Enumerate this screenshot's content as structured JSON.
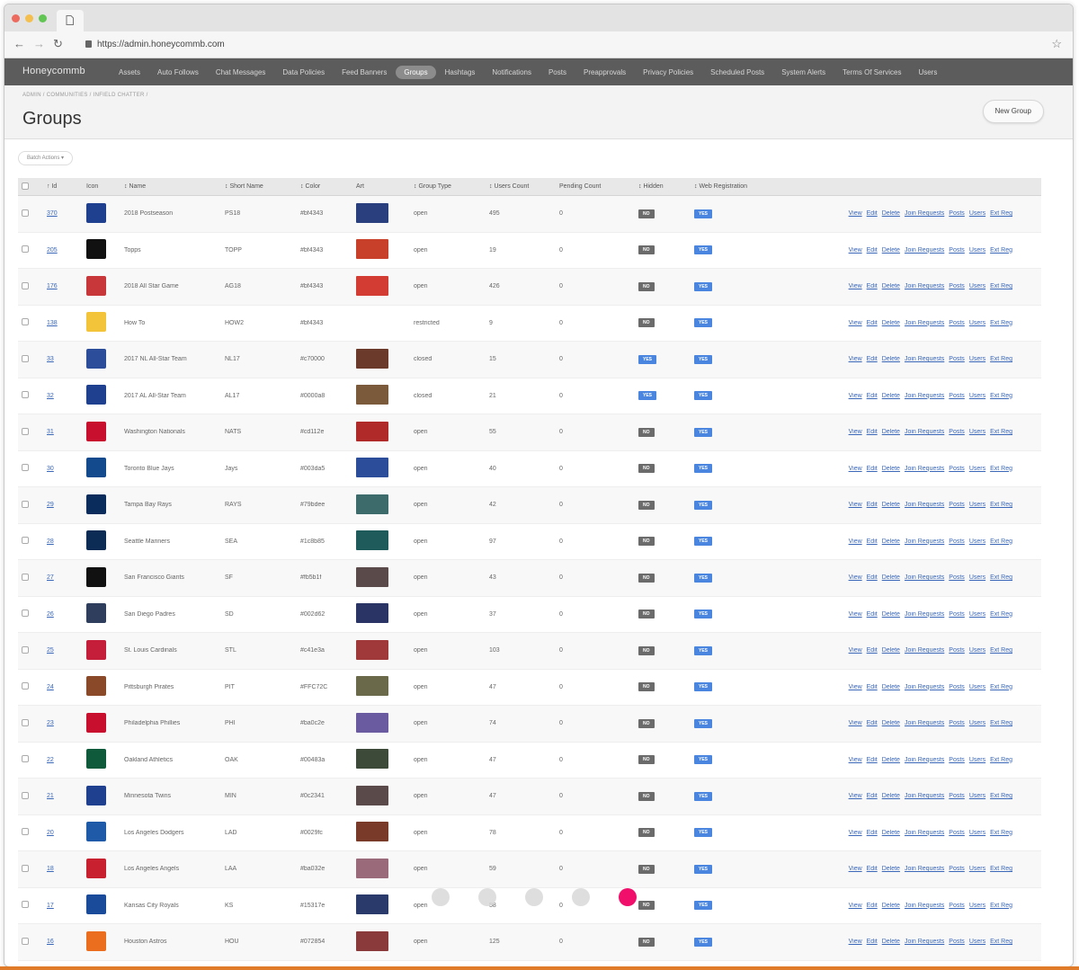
{
  "browser": {
    "url": "https://admin.honeycommb.com"
  },
  "app": {
    "brand": "Honeycommb",
    "nav": [
      "Assets",
      "Auto Follows",
      "Chat Messages",
      "Data Policies",
      "Feed Banners",
      "Groups",
      "Hashtags",
      "Notifications",
      "Posts",
      "Preapprovals",
      "Privacy Policies",
      "Scheduled Posts",
      "System Alerts",
      "Terms Of Services",
      "Users"
    ],
    "active_nav": "Groups"
  },
  "page": {
    "breadcrumb": "ADMIN / COMMUNITIES / INFIELD CHATTER /",
    "title": "Groups",
    "new_button": "New Group",
    "batch_actions": "Batch Actions ▾"
  },
  "table": {
    "headers": [
      "↑ Id",
      "Icon",
      "↕ Name",
      "↕ Short Name",
      "↕ Color",
      "Art",
      "↕ Group Type",
      "↕ Users Count",
      "Pending Count",
      "↕ Hidden",
      "↕ Web Registration"
    ],
    "actions": [
      "View",
      "Edit",
      "Delete",
      "Join Requests",
      "Posts",
      "Users",
      "Ext Reg"
    ],
    "rows": [
      {
        "id": "370",
        "name": "2018 Postseason",
        "short": "PS18",
        "color": "#bf4343",
        "type": "open",
        "users": "495",
        "pending": "0",
        "hidden": "NO",
        "web": "YES",
        "icon_color": "#1f3f8f",
        "art_color": "#2a3f7e"
      },
      {
        "id": "205",
        "name": "Topps",
        "short": "TOPP",
        "color": "#bf4343",
        "type": "open",
        "users": "19",
        "pending": "0",
        "hidden": "NO",
        "web": "YES",
        "icon_color": "#111111",
        "art_color": "#c8402a"
      },
      {
        "id": "176",
        "name": "2018 All Star Game",
        "short": "AG18",
        "color": "#bf4343",
        "type": "open",
        "users": "426",
        "pending": "0",
        "hidden": "NO",
        "web": "YES",
        "icon_color": "#c8383a",
        "art_color": "#d23c33"
      },
      {
        "id": "138",
        "name": "How To",
        "short": "HOW2",
        "color": "#bf4343",
        "type": "restricted",
        "users": "9",
        "pending": "0",
        "hidden": "NO",
        "web": "YES",
        "icon_color": "#f3c33a",
        "art_color": "#ffffff"
      },
      {
        "id": "33",
        "name": "2017 NL All-Star Team",
        "short": "NL17",
        "color": "#c70000",
        "type": "closed",
        "users": "15",
        "pending": "0",
        "hidden": "YES",
        "web": "YES",
        "icon_color": "#2c4d9a",
        "art_color": "#6b3a2a"
      },
      {
        "id": "32",
        "name": "2017 AL All-Star Team",
        "short": "AL17",
        "color": "#0000a8",
        "type": "closed",
        "users": "21",
        "pending": "0",
        "hidden": "YES",
        "web": "YES",
        "icon_color": "#1f3f8f",
        "art_color": "#7a5a3a"
      },
      {
        "id": "31",
        "name": "Washington Nationals",
        "short": "NATS",
        "color": "#cd112e",
        "type": "open",
        "users": "55",
        "pending": "0",
        "hidden": "NO",
        "web": "YES",
        "icon_color": "#c8102e",
        "art_color": "#b02a2a"
      },
      {
        "id": "30",
        "name": "Toronto Blue Jays",
        "short": "Jays",
        "color": "#003da5",
        "type": "open",
        "users": "40",
        "pending": "0",
        "hidden": "NO",
        "web": "YES",
        "icon_color": "#134a8e",
        "art_color": "#2c4d9a"
      },
      {
        "id": "29",
        "name": "Tampa Bay Rays",
        "short": "RAYS",
        "color": "#79bdee",
        "type": "open",
        "users": "42",
        "pending": "0",
        "hidden": "NO",
        "web": "YES",
        "icon_color": "#092c5c",
        "art_color": "#3d6a6a"
      },
      {
        "id": "28",
        "name": "Seattle Mariners",
        "short": "SEA",
        "color": "#1c8b85",
        "type": "open",
        "users": "97",
        "pending": "0",
        "hidden": "NO",
        "web": "YES",
        "icon_color": "#0c2c56",
        "art_color": "#1f5b5a"
      },
      {
        "id": "27",
        "name": "San Francisco Giants",
        "short": "SF",
        "color": "#fb5b1f",
        "type": "open",
        "users": "43",
        "pending": "0",
        "hidden": "NO",
        "web": "YES",
        "icon_color": "#111111",
        "art_color": "#5a4a4a"
      },
      {
        "id": "26",
        "name": "San Diego Padres",
        "short": "SD",
        "color": "#002d62",
        "type": "open",
        "users": "37",
        "pending": "0",
        "hidden": "NO",
        "web": "YES",
        "icon_color": "#2f3e5c",
        "art_color": "#2a3566"
      },
      {
        "id": "25",
        "name": "St. Louis Cardinals",
        "short": "STL",
        "color": "#c41e3a",
        "type": "open",
        "users": "103",
        "pending": "0",
        "hidden": "NO",
        "web": "YES",
        "icon_color": "#c41e3a",
        "art_color": "#a03a3a"
      },
      {
        "id": "24",
        "name": "Pittsburgh Pirates",
        "short": "PIT",
        "color": "#FFC72C",
        "type": "open",
        "users": "47",
        "pending": "0",
        "hidden": "NO",
        "web": "YES",
        "icon_color": "#8a4a2a",
        "art_color": "#6a6a4a"
      },
      {
        "id": "23",
        "name": "Philadelphia Phillies",
        "short": "PHI",
        "color": "#ba0c2e",
        "type": "open",
        "users": "74",
        "pending": "0",
        "hidden": "NO",
        "web": "YES",
        "icon_color": "#c8102e",
        "art_color": "#6a5aa0"
      },
      {
        "id": "22",
        "name": "Oakland Athletics",
        "short": "OAK",
        "color": "#00483a",
        "type": "open",
        "users": "47",
        "pending": "0",
        "hidden": "NO",
        "web": "YES",
        "icon_color": "#0f5a3a",
        "art_color": "#3d4a3a"
      },
      {
        "id": "21",
        "name": "Minnesota Twins",
        "short": "MIN",
        "color": "#0c2341",
        "type": "open",
        "users": "47",
        "pending": "0",
        "hidden": "NO",
        "web": "YES",
        "icon_color": "#1f3f8f",
        "art_color": "#5a4a4a"
      },
      {
        "id": "20",
        "name": "Los Angeles Dodgers",
        "short": "LAD",
        "color": "#0029fc",
        "type": "open",
        "users": "78",
        "pending": "0",
        "hidden": "NO",
        "web": "YES",
        "icon_color": "#1e5aa8",
        "art_color": "#7a3a2a"
      },
      {
        "id": "18",
        "name": "Los Angeles Angels",
        "short": "LAA",
        "color": "#ba032e",
        "type": "open",
        "users": "59",
        "pending": "0",
        "hidden": "NO",
        "web": "YES",
        "icon_color": "#c8202e",
        "art_color": "#9a6a7a"
      },
      {
        "id": "17",
        "name": "Kansas City Royals",
        "short": "KS",
        "color": "#15317e",
        "type": "open",
        "users": "58",
        "pending": "0",
        "hidden": "NO",
        "web": "YES",
        "icon_color": "#1a4a9a",
        "art_color": "#2a3a6a"
      },
      {
        "id": "16",
        "name": "Houston Astros",
        "short": "HOU",
        "color": "#072854",
        "type": "open",
        "users": "125",
        "pending": "0",
        "hidden": "NO",
        "web": "YES",
        "icon_color": "#eb6e1f",
        "art_color": "#8a3a3a"
      }
    ]
  },
  "pager": {
    "count": 5,
    "active_index": 4,
    "active_color": "#f0106b"
  }
}
